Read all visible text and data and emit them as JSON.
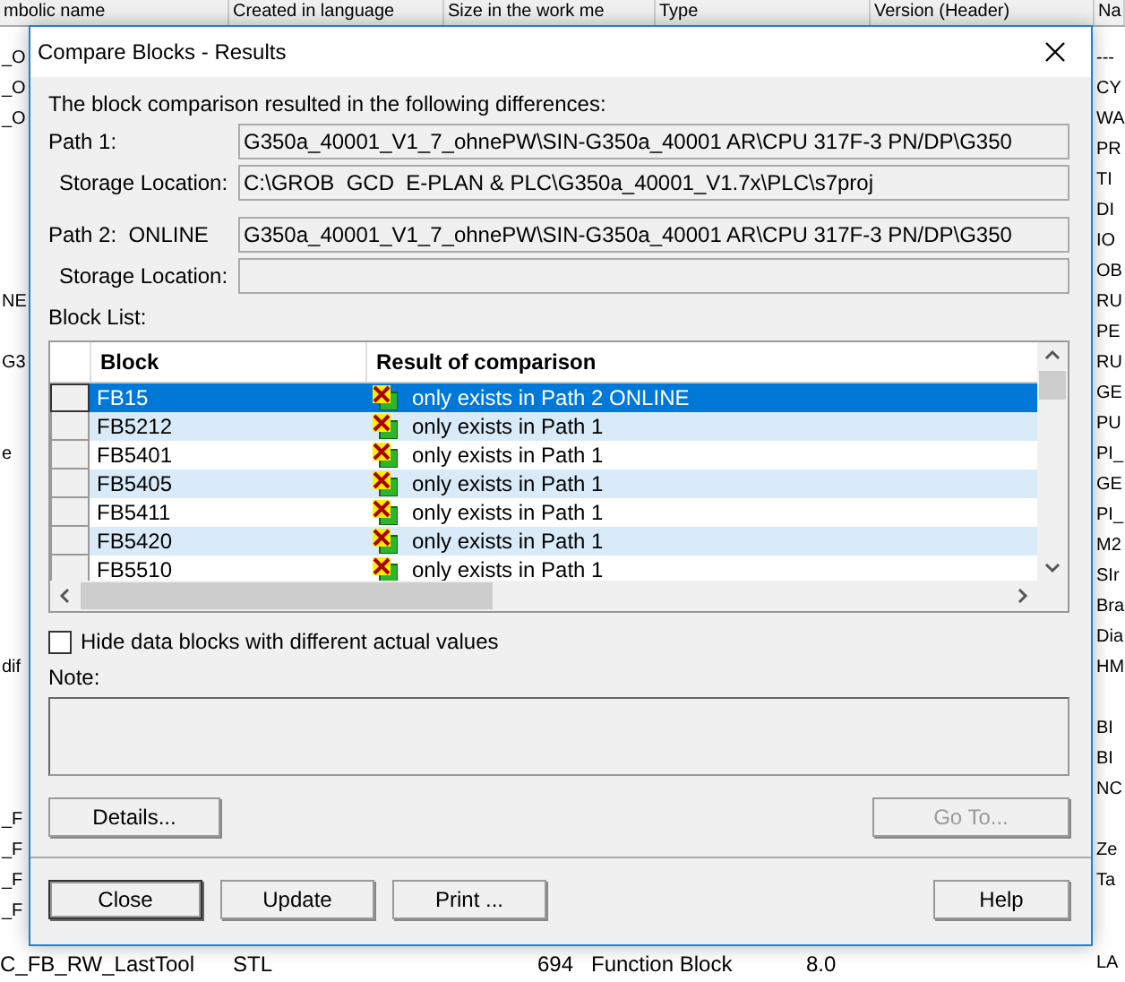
{
  "background_table": {
    "columns": [
      "mbolic name",
      "Created in language",
      "Size in the work me",
      "Type",
      "Version (Header)",
      "Na"
    ],
    "left_fragments": [
      "_O",
      "_O",
      "_O",
      "NE",
      "G3",
      "e",
      "dif",
      "_F",
      "_F",
      "_F",
      "_F"
    ],
    "right_fragments": [
      "---",
      "CY",
      "WA",
      "PR",
      "TI",
      "DI",
      "IO",
      "OB",
      "RU",
      "PE",
      "RU",
      "GE",
      "PU",
      "PI_",
      "GE",
      "PI_",
      "M2",
      "SIr",
      "Bra",
      "Dia",
      "HM",
      "BI",
      "BI",
      "NC",
      "Ze",
      "Ta"
    ],
    "bottom_row": [
      "C_FB_RW_LastTool",
      "STL",
      "694",
      "Function Block",
      "8.0",
      "LA"
    ]
  },
  "dialog": {
    "title": "Compare Blocks - Results",
    "intro": "The block comparison resulted in the following differences:",
    "paths": [
      {
        "label": "Path 1:",
        "path": "G350a_40001_V1_7_ohnePW\\SIN-G350a_40001 AR\\CPU 317F-3 PN/DP\\G350",
        "storage_label": "Storage Location:",
        "storage": "C:\\GROB  GCD  E-PLAN & PLC\\G350a_40001_V1.7x\\PLC\\s7proj"
      },
      {
        "label": "Path 2:  ONLINE",
        "path": "G350a_40001_V1_7_ohnePW\\SIN-G350a_40001 AR\\CPU 317F-3 PN/DP\\G350",
        "storage_label": "Storage Location:"
      }
    ],
    "block_list": {
      "label": "Block List:",
      "columns": [
        "Block",
        "Result of comparison"
      ],
      "rows": [
        {
          "block": "FB15",
          "result": "only exists in Path 2 ONLINE",
          "selected": true
        },
        {
          "block": "FB5212",
          "result": "only exists in Path 1",
          "selected": false
        },
        {
          "block": "FB5401",
          "result": "only exists in Path 1",
          "selected": false
        },
        {
          "block": "FB5405",
          "result": "only exists in Path 1",
          "selected": false
        },
        {
          "block": "FB5411",
          "result": "only exists in Path 1",
          "selected": false
        },
        {
          "block": "FB5420",
          "result": "only exists in Path 1",
          "selected": false
        },
        {
          "block": "FB5510",
          "result": "only exists in Path 1",
          "selected": false
        }
      ]
    },
    "hide_data_blocks": {
      "label": "Hide data blocks with different actual values",
      "checked": false
    },
    "note_label": "Note:",
    "details_button": {
      "label": "Details...",
      "disabled": false
    },
    "goto_button": {
      "label": "Go To...",
      "disabled": true
    },
    "buttons": [
      {
        "label": "Close",
        "default": true
      },
      {
        "label": "Update",
        "default": false
      },
      {
        "label": "Print ...",
        "default": false
      },
      {
        "label": "Help",
        "default": false
      }
    ]
  }
}
